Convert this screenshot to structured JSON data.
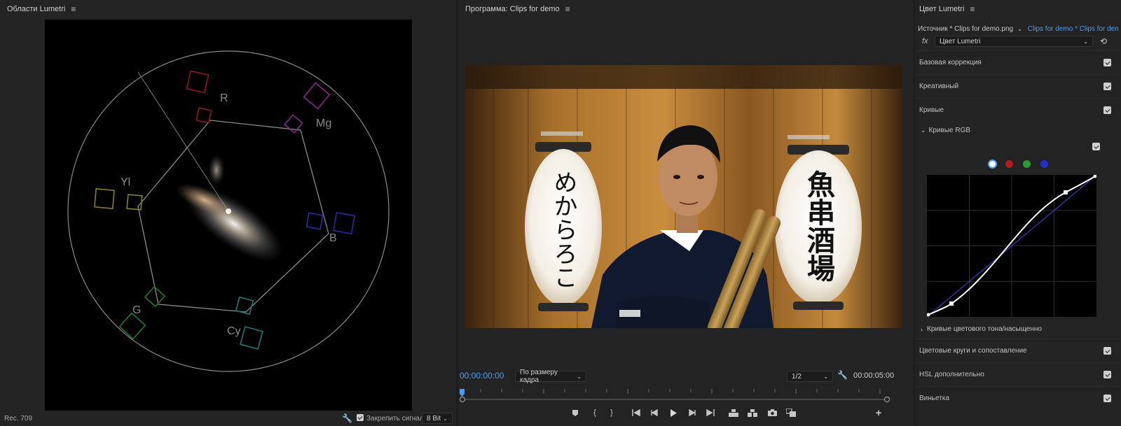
{
  "scopes": {
    "title": "Области Lumetri",
    "labels": {
      "r": "R",
      "mg": "Mg",
      "yl": "Yl",
      "b": "B",
      "g": "G",
      "cy": "Cy"
    },
    "footer": {
      "standard": "Rec. 709",
      "clamp_label": "Закрепить сигнал",
      "bit_depth": "8 Bit"
    }
  },
  "program": {
    "title": "Программа: Clips for demo",
    "timecode_current": "00:00:00:00",
    "fit_option": "По размеру кадра",
    "resolution": "1/2",
    "timecode_total": "00:00:05:00",
    "lantern_left": "めからろこ",
    "lantern_right": "魚串酒場"
  },
  "lumetri": {
    "title": "Цвет Lumetri",
    "source_label": "Источник * Clips for demo.png",
    "sequence_label": "Clips for demo * Clips for demo.p...",
    "fx_label": "fx",
    "effect_name": "Цвет Lumetri",
    "sections": {
      "basic": "Базовая коррекция",
      "creative": "Креативный",
      "curves": "Кривые",
      "rgb_curves": "Кривые RGB",
      "hue_sat": "Кривые цветового тона/насыщенно",
      "wheels": "Цветовые круги и сопоставление",
      "hsl": "HSL дополнительно",
      "vignette": "Виньетка"
    },
    "channel_colors": {
      "luma": "#ffffff",
      "red": "#b51d1d",
      "green": "#2f9a2f",
      "blue": "#1f2fd1"
    },
    "accent": "#4e9cf1"
  }
}
